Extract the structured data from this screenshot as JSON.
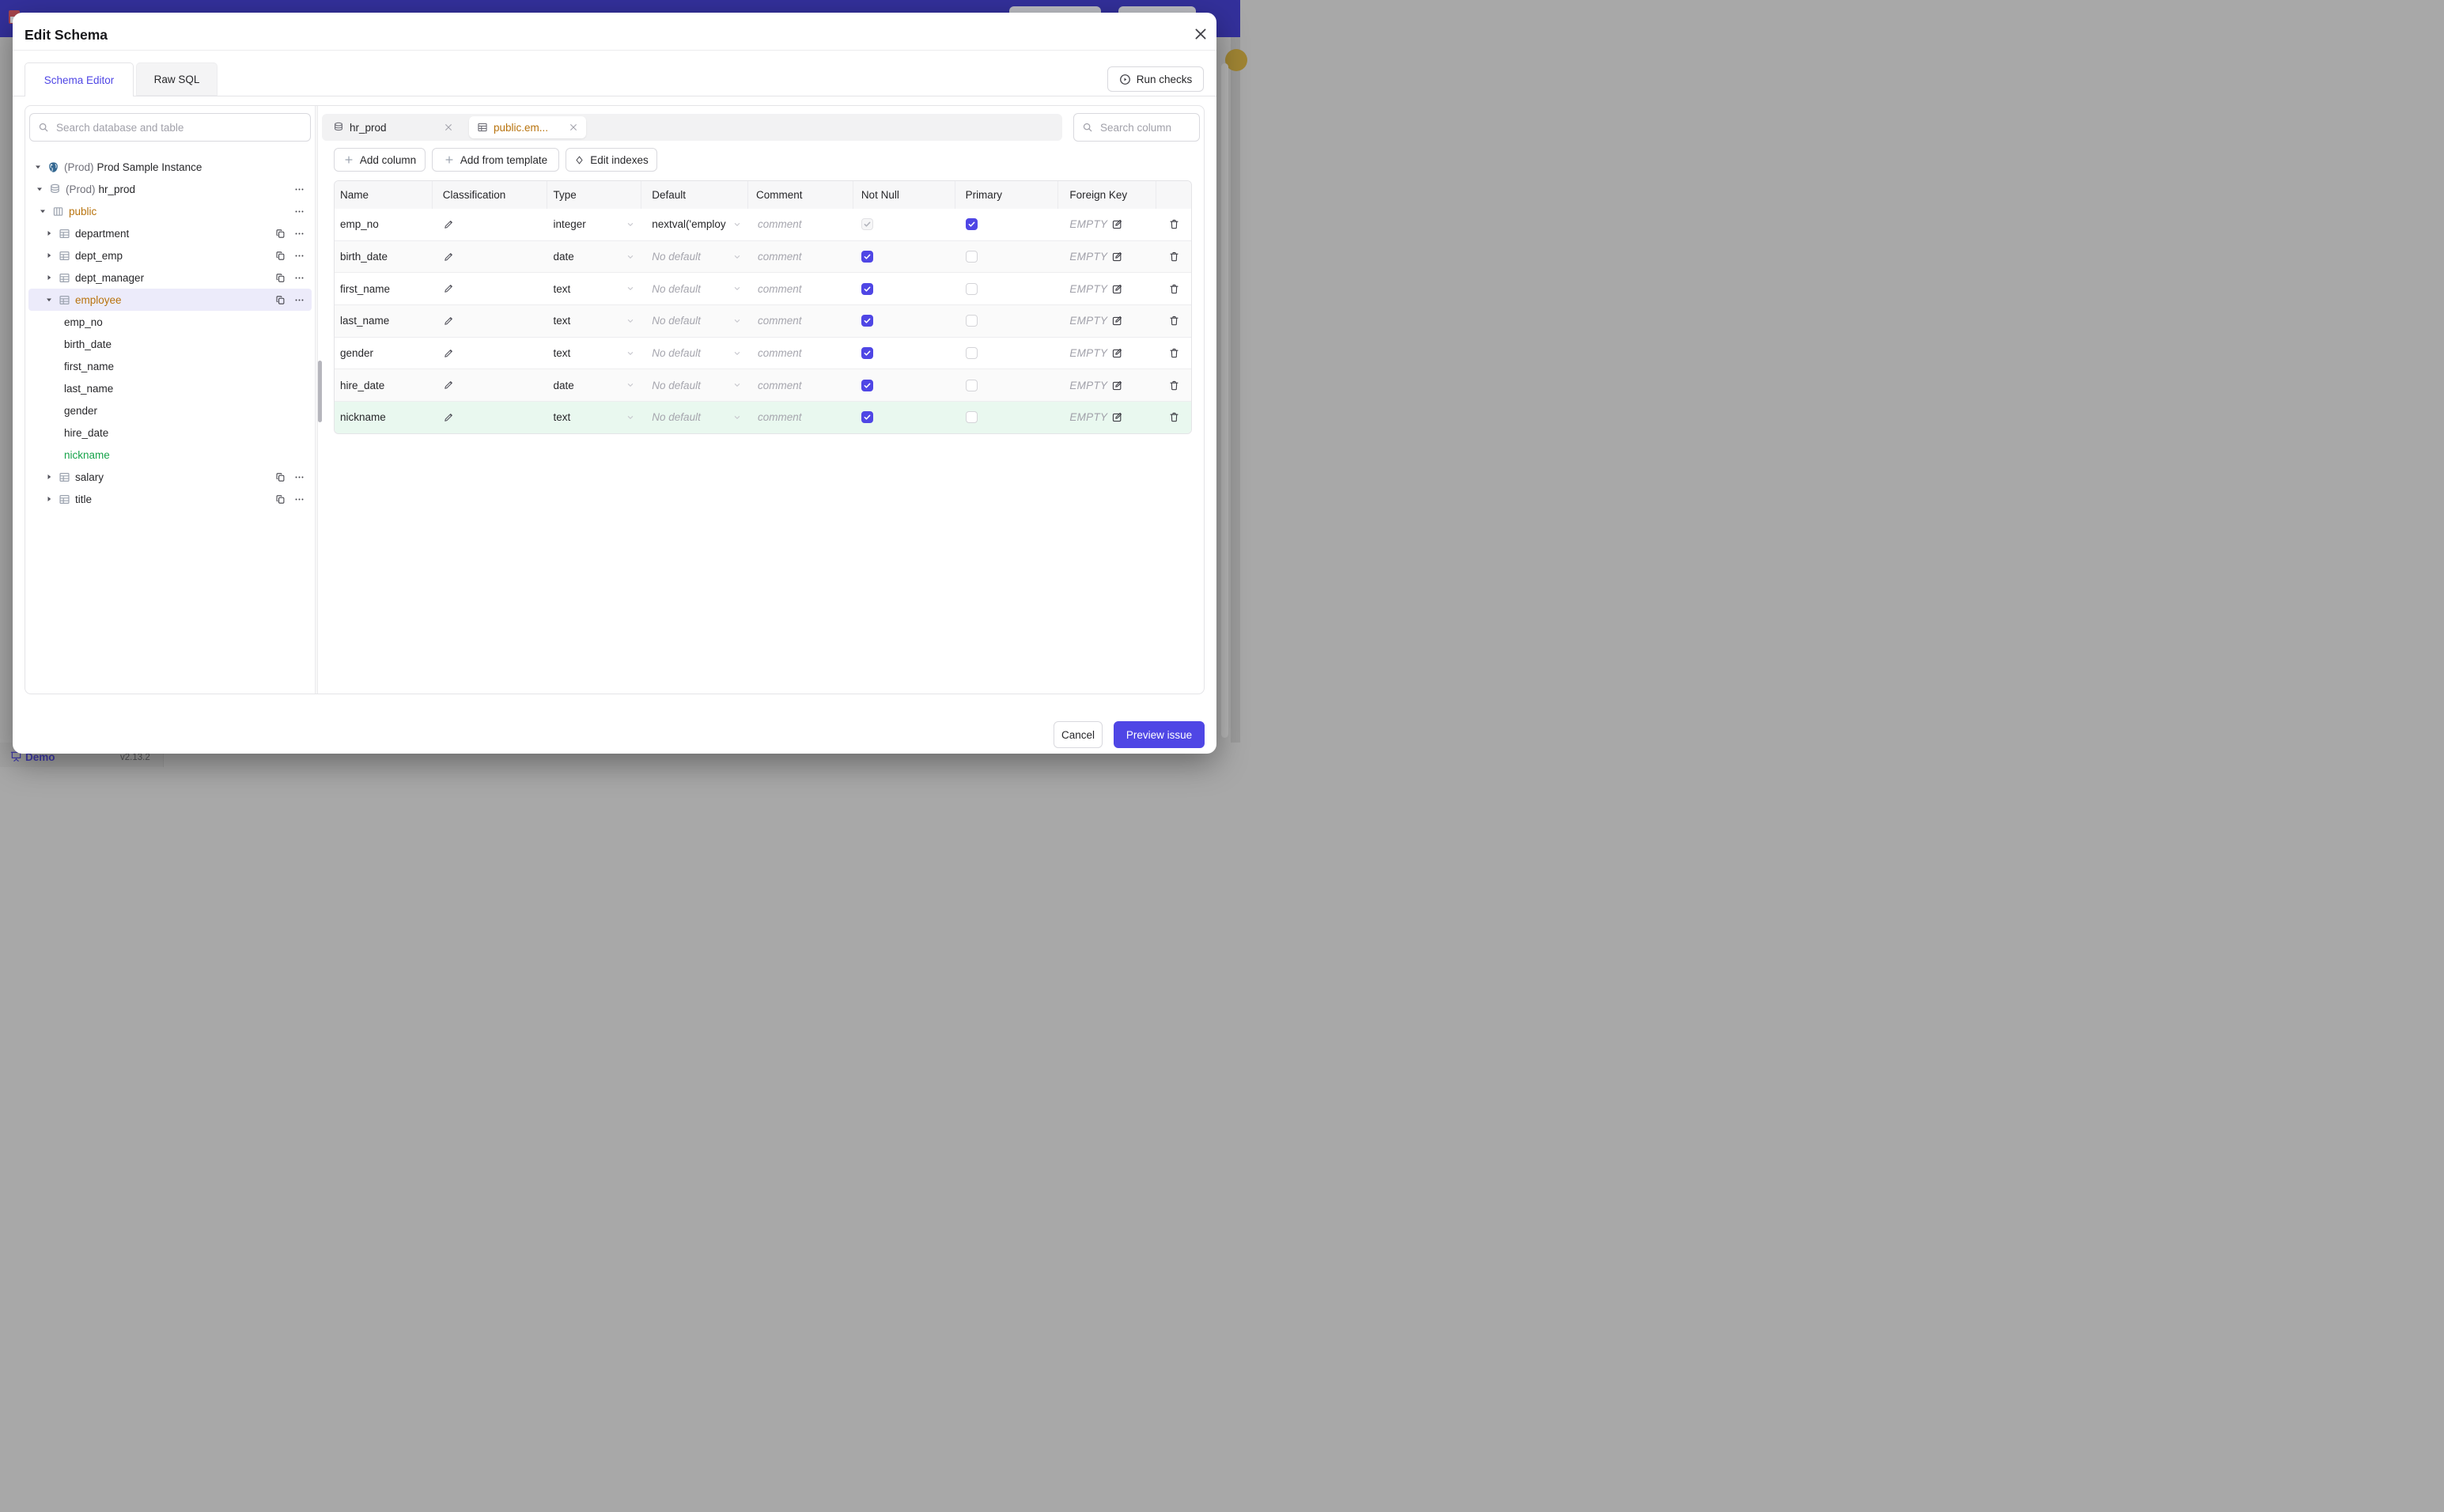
{
  "page": {
    "demo_label": "Demo",
    "version": "v2.13.2"
  },
  "modal": {
    "title": "Edit Schema",
    "tabs": [
      {
        "label": "Schema Editor",
        "active": true
      },
      {
        "label": "Raw SQL",
        "active": false
      }
    ],
    "run_checks_label": "Run checks"
  },
  "sidebar": {
    "search_placeholder": "Search database and table",
    "tree": [
      {
        "prefix": "(Prod)",
        "label": "Prod Sample Instance",
        "icon": "postgres-icon",
        "level": 1,
        "expanded": true
      },
      {
        "prefix": "(Prod)",
        "label": "hr_prod",
        "icon": "database-icon",
        "level": 2,
        "expanded": true
      },
      {
        "label": "public",
        "icon": "schema-icon",
        "level": 3,
        "expanded": true
      },
      {
        "label": "department",
        "icon": "table-icon",
        "level": 4,
        "expanded": false
      },
      {
        "label": "dept_emp",
        "icon": "table-icon",
        "level": 4,
        "expanded": false
      },
      {
        "label": "dept_manager",
        "icon": "table-icon",
        "level": 4,
        "expanded": false
      },
      {
        "label": "employee",
        "icon": "table-icon",
        "level": 4,
        "expanded": true,
        "selected": true
      },
      {
        "label": "emp_no",
        "level": "column"
      },
      {
        "label": "birth_date",
        "level": "column"
      },
      {
        "label": "first_name",
        "level": "column"
      },
      {
        "label": "last_name",
        "level": "column"
      },
      {
        "label": "gender",
        "level": "column"
      },
      {
        "label": "hire_date",
        "level": "column"
      },
      {
        "label": "nickname",
        "level": "column",
        "new": true
      },
      {
        "label": "salary",
        "icon": "table-icon",
        "level": 4,
        "expanded": false
      },
      {
        "label": "title",
        "icon": "table-icon",
        "level": 4,
        "expanded": false
      }
    ]
  },
  "editor": {
    "tabs": [
      {
        "label": "hr_prod",
        "icon": "database-icon",
        "active": false
      },
      {
        "label": "public.em...",
        "icon": "table-icon",
        "active": true
      }
    ],
    "toolbar": {
      "add_column": "Add column",
      "add_from_template": "Add from template",
      "edit_indexes": "Edit indexes"
    },
    "search_placeholder": "Search column",
    "table": {
      "headers": [
        "Name",
        "Classification",
        "Type",
        "Default",
        "Comment",
        "Not Null",
        "Primary",
        "Foreign Key"
      ],
      "comment_placeholder": "comment",
      "foreign_key_empty_label": "EMPTY",
      "rows": [
        {
          "name": "emp_no",
          "type": "integer",
          "default": "nextval('employ",
          "default_is_placeholder": false,
          "not_null": "checked_disabled",
          "primary": "checked",
          "new": false
        },
        {
          "name": "birth_date",
          "type": "date",
          "default": "No default",
          "default_is_placeholder": true,
          "not_null": "checked",
          "primary": "unchecked",
          "new": false
        },
        {
          "name": "first_name",
          "type": "text",
          "default": "No default",
          "default_is_placeholder": true,
          "not_null": "checked",
          "primary": "unchecked",
          "new": false
        },
        {
          "name": "last_name",
          "type": "text",
          "default": "No default",
          "default_is_placeholder": true,
          "not_null": "checked",
          "primary": "unchecked",
          "new": false
        },
        {
          "name": "gender",
          "type": "text",
          "default": "No default",
          "default_is_placeholder": true,
          "not_null": "checked",
          "primary": "unchecked",
          "new": false
        },
        {
          "name": "hire_date",
          "type": "date",
          "default": "No default",
          "default_is_placeholder": true,
          "not_null": "checked",
          "primary": "unchecked",
          "new": false
        },
        {
          "name": "nickname",
          "type": "text",
          "default": "No default",
          "default_is_placeholder": true,
          "not_null": "checked",
          "primary": "unchecked",
          "new": true
        }
      ]
    }
  },
  "footer": {
    "cancel_label": "Cancel",
    "preview_label": "Preview issue"
  },
  "colors": {
    "accent": "#4f46e5",
    "schema_highlight_text": "#b8730d",
    "new_column_text": "#16a34a",
    "new_row_bg": "#e9f8ef",
    "selected_tree_row_bg": "#ecebfa",
    "banner_dimmed": "#33309b"
  }
}
